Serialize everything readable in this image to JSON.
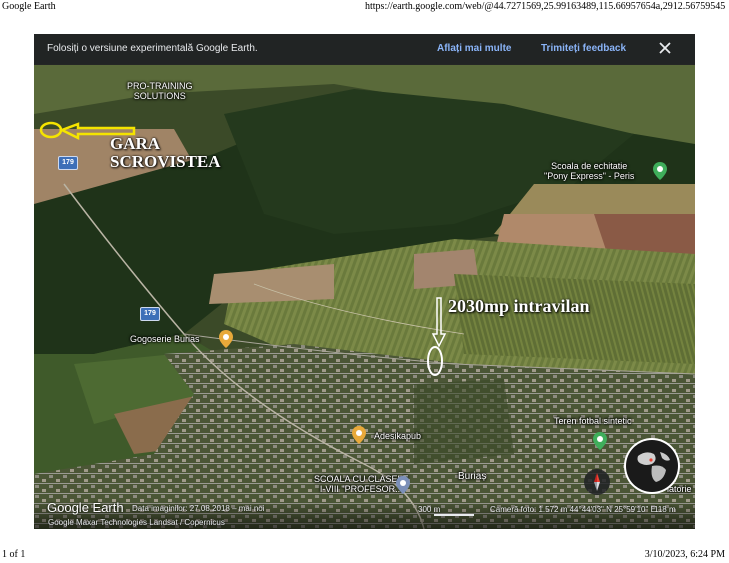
{
  "print": {
    "title": "Google Earth",
    "url": "https://earth.google.com/web/@44.7271569,25.99163489,115.66957654a,2912.56759545d,35...",
    "page": "1 of 1",
    "datetime": "3/10/2023, 6:24 PM"
  },
  "banner": {
    "text": "Folosiți o versiune experimentală Google Earth.",
    "learn_more": "Aflați mai multe",
    "feedback": "Trimiteți feedback"
  },
  "labels": {
    "pro_training_line1": "PRO-TRAINING",
    "pro_training_line2": "SOLUTIONS",
    "scoala_ecvestra_line1": "Scoala de echitatie",
    "scoala_ecvestra_line2": "\"Pony Express\" - Peris",
    "gogoserie": "Gogoserie Burias",
    "adesikapub": "Adesikapub",
    "teren_fotbal": "Teren fotbal sintetic",
    "scoala_line1": "SCOALA CU CLASELE",
    "scoala_line2": "I-VIII \"PROFESOR...",
    "burias": "Buriaș",
    "partial_label": "iatorie",
    "road_number": "179"
  },
  "annotations": {
    "gara_line1": "GARA",
    "gara_line2": "SCROVISTEA",
    "plot": "2030mp intravilan"
  },
  "footer": {
    "logo": "Google Earth",
    "attribution": "Google   Maxar Technologies   Landsat / Copernicus",
    "image_date": "Data imaginilor: 27.08.2018 – mai noi",
    "scale": "300 m",
    "camera": "Cameră foto: 1.572 m   44°44'03\" N 25°59'10\" E",
    "altitude": "118 m"
  },
  "colors": {
    "banner_bg": "#202124",
    "link": "#8ab4f8",
    "forest": "#1f3319",
    "field": "#6e7a44",
    "pin": "#e8a93a",
    "pin_green": "#3fae5b",
    "road_badge": "#3d6fb8",
    "annotation_yellow": "#f5e400"
  }
}
